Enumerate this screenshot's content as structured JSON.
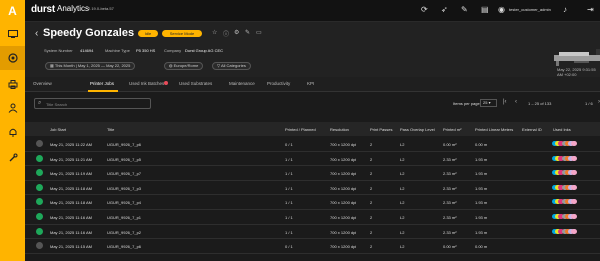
{
  "colors": {
    "accent": "#ffb400",
    "sidebar_bg": "#ffb400",
    "ok": "#1ea85a",
    "neutral": "#555555",
    "error_dot": "#e94b5a"
  },
  "sidebar": {
    "logo": "A",
    "items": [
      {
        "icon": "grid-icon"
      },
      {
        "icon": "analytics-icon"
      },
      {
        "icon": "printer-icon"
      },
      {
        "icon": "user-icon"
      },
      {
        "icon": "bell-icon"
      },
      {
        "icon": "wrench-icon"
      }
    ]
  },
  "topbar": {
    "brand": "durst",
    "app": "Analytics",
    "version": "2.19.0-beta.57",
    "user": "tester_customer_admin"
  },
  "machine": {
    "name": "Speedy Gonzales",
    "status": "Idle",
    "mode": "Service Mode",
    "serial_label": "System Number",
    "serial": "414694",
    "type_label": "Machine Type",
    "type": "P5 350 HS",
    "company_label": "Company",
    "company": "Durst Group AG CEC",
    "chips": [
      "This Month  |  May 1, 2025 — May 22, 2025",
      "Europe/Rome",
      "All Categories"
    ],
    "timestamp": "May 22, 2025 9:31:55 AM +02:00"
  },
  "tabs": [
    "Overview",
    "Printer Jobs",
    "Used Ink Batches",
    "Used Substrates",
    "Maintenance",
    "Productivity",
    "KPI"
  ],
  "active_tab": "Printer Jobs",
  "filter": {
    "placeholder": "Title Search",
    "per_page_label": "Items per page",
    "per_page": "25",
    "range": "1 – 25 of 133",
    "page": "1 / 6"
  },
  "table": {
    "headers": [
      "Job Start",
      "Title",
      "Printed / Planned",
      "Resolution",
      "Print Passes",
      "Pass Overlap Level",
      "Printed m²",
      "Printed Linear Meters",
      "External ID",
      "Used Inks"
    ],
    "rows": [
      {
        "status": "neutral",
        "start": "May 21, 2025 11:22 AM",
        "title": "UGUR_9926_7_p6",
        "printed": "0 / 1",
        "res": "700 x 1200 dpi",
        "passes": "2",
        "overlap": "L2",
        "m2": "0.00 m²",
        "lm": "0.00 m",
        "ext": "",
        "inks": true
      },
      {
        "status": "ok",
        "start": "May 21, 2025 11:21 AM",
        "title": "UGUR_9926_7_p5",
        "printed": "1 / 1",
        "res": "700 x 1200 dpi",
        "passes": "2",
        "overlap": "L2",
        "m2": "2.33 m²",
        "lm": "1.93 m",
        "ext": "",
        "inks": true
      },
      {
        "status": "ok",
        "start": "May 21, 2025 11:19 AM",
        "title": "UGUR_9926_7_p7",
        "printed": "1 / 1",
        "res": "700 x 1200 dpi",
        "passes": "2",
        "overlap": "L2",
        "m2": "2.33 m²",
        "lm": "1.93 m",
        "ext": "",
        "inks": true
      },
      {
        "status": "ok",
        "start": "May 21, 2025 11:18 AM",
        "title": "UGUR_9926_7_p3",
        "printed": "1 / 1",
        "res": "700 x 1200 dpi",
        "passes": "2",
        "overlap": "L2",
        "m2": "2.33 m²",
        "lm": "1.93 m",
        "ext": "",
        "inks": true
      },
      {
        "status": "ok",
        "start": "May 21, 2025 11:18 AM",
        "title": "UGUR_9926_7_p4",
        "printed": "1 / 1",
        "res": "700 x 1200 dpi",
        "passes": "2",
        "overlap": "L2",
        "m2": "2.33 m²",
        "lm": "1.93 m",
        "ext": "",
        "inks": true
      },
      {
        "status": "ok",
        "start": "May 21, 2025 11:16 AM",
        "title": "UGUR_9926_7_p1",
        "printed": "1 / 1",
        "res": "700 x 1200 dpi",
        "passes": "2",
        "overlap": "L2",
        "m2": "2.33 m²",
        "lm": "1.93 m",
        "ext": "",
        "inks": true
      },
      {
        "status": "ok",
        "start": "May 21, 2025 11:16 AM",
        "title": "UGUR_9926_7_p2",
        "printed": "1 / 1",
        "res": "700 x 1200 dpi",
        "passes": "2",
        "overlap": "L2",
        "m2": "2.33 m²",
        "lm": "1.93 m",
        "ext": "",
        "inks": true
      },
      {
        "status": "neutral",
        "start": "May 21, 2025 11:15 AM",
        "title": "UGUR_9926_7_p6",
        "printed": "0 / 1",
        "res": "700 x 1200 dpi",
        "passes": "2",
        "overlap": "L2",
        "m2": "0.00 m²",
        "lm": "0.00 m",
        "ext": "",
        "inks": false
      }
    ]
  },
  "ink_colors": [
    "#00a7e1",
    "#e5e529",
    "#e0337e",
    "#9a9a9a",
    "#f07a2a",
    "#c4b5e8",
    "#f4a6c8"
  ]
}
